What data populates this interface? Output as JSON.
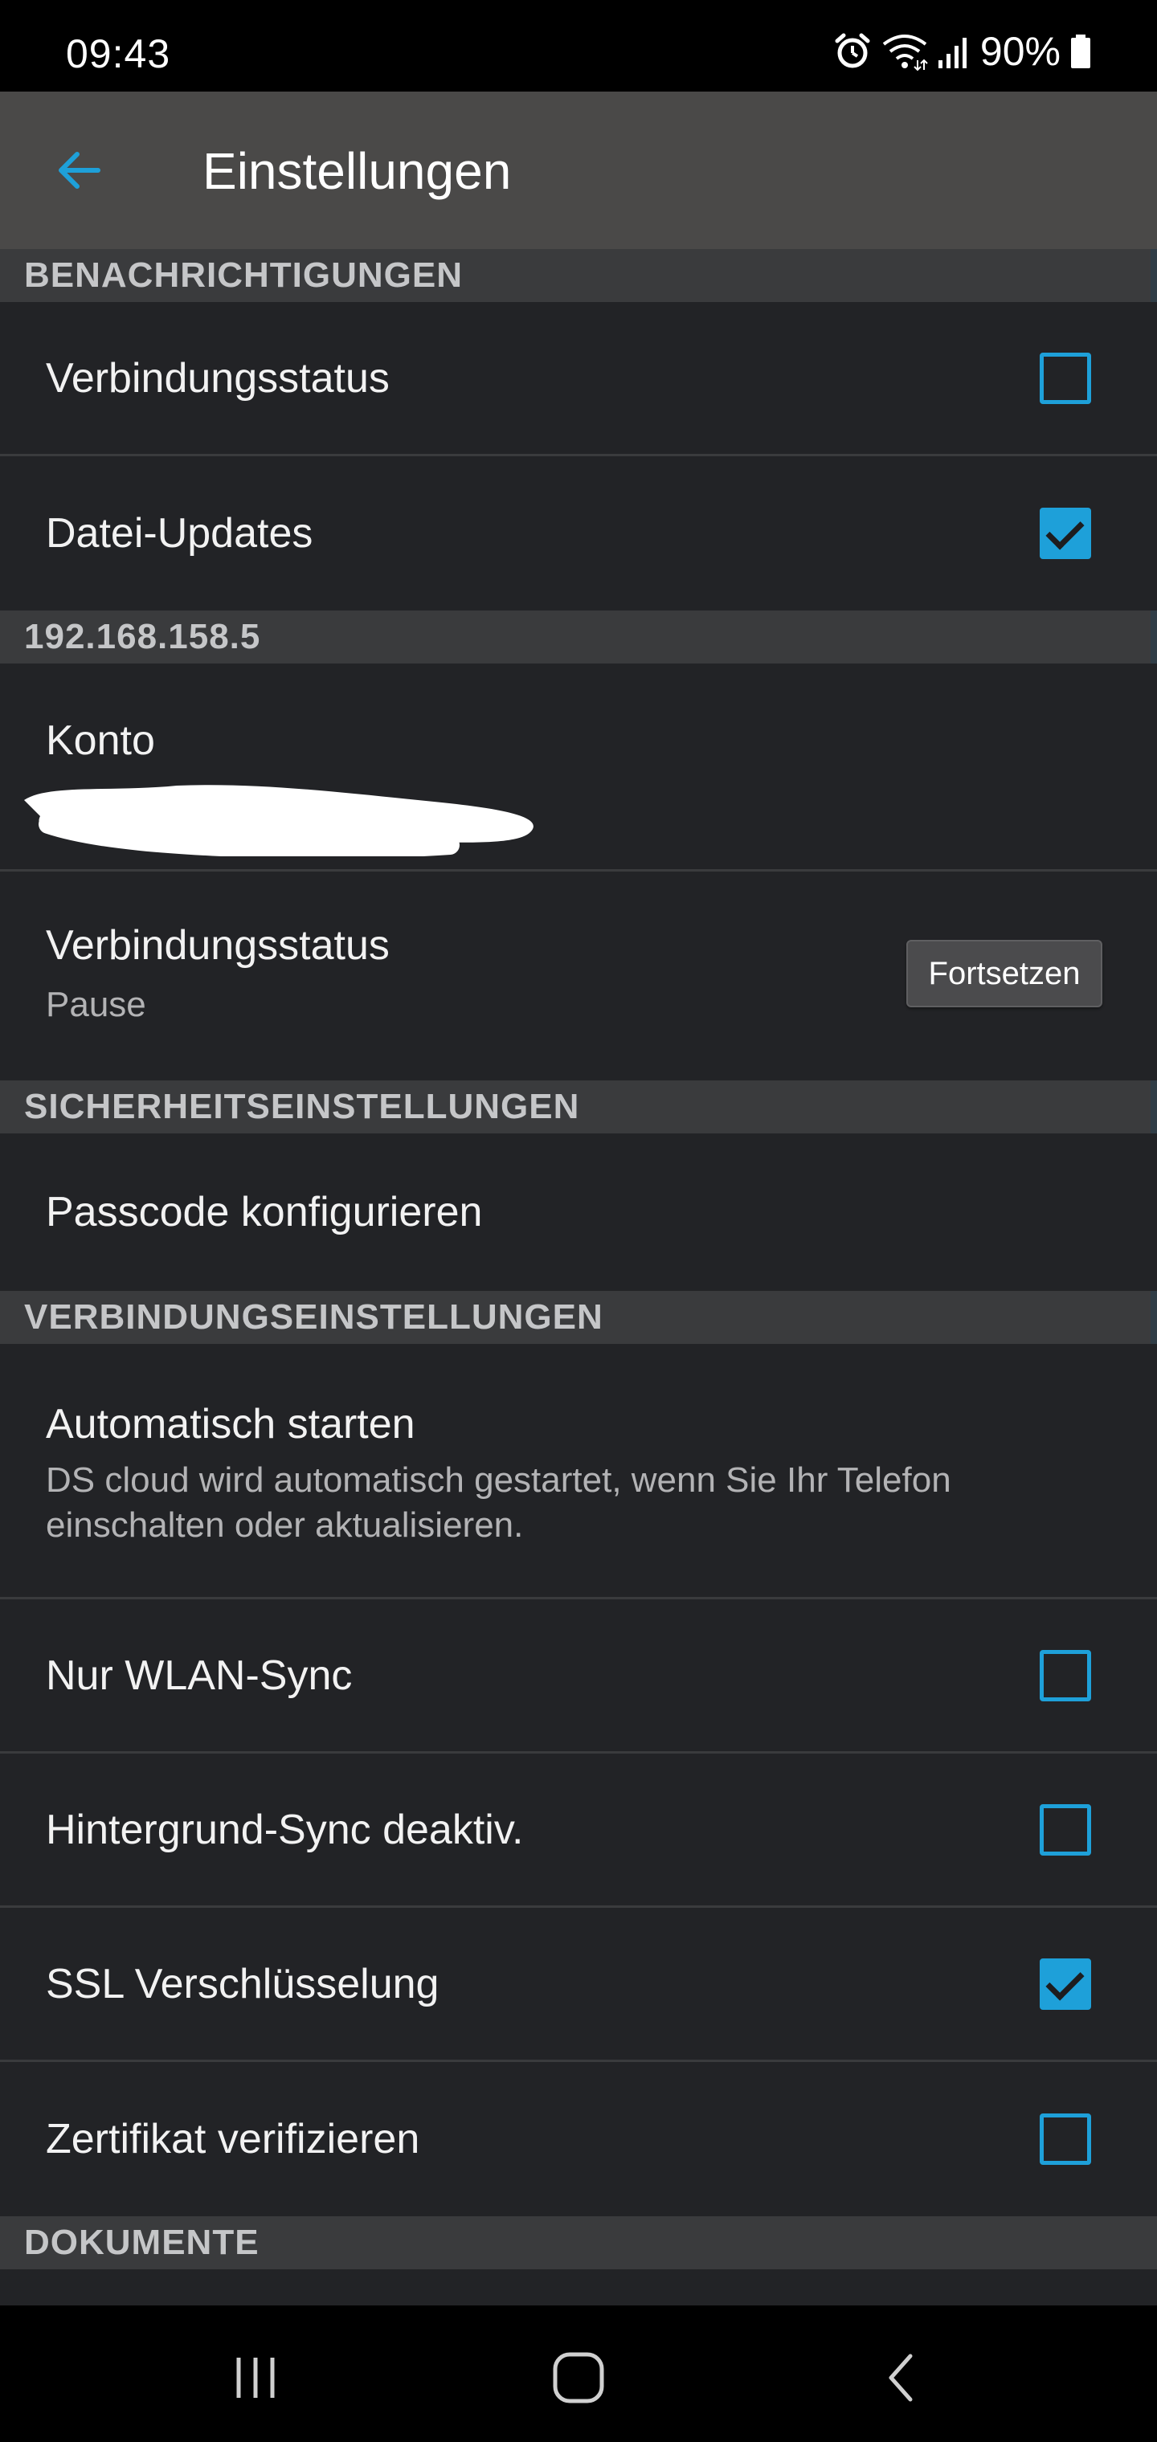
{
  "status_bar": {
    "time": "09:43",
    "battery": "90%",
    "icons": [
      "alarm-icon",
      "wifi-icon",
      "signal-icon",
      "battery-icon"
    ]
  },
  "app_bar": {
    "title": "Einstellungen",
    "back_icon": "arrow-left-icon"
  },
  "colors": {
    "accent": "#1ea0d9",
    "background": "#222326",
    "section_header": "#3a3b3d",
    "app_bar": "#4a4948"
  },
  "sections": {
    "notifications": {
      "header": "BENACHRICHTIGUNGEN",
      "connection_status": {
        "label": "Verbindungsstatus",
        "checked": false
      },
      "file_updates": {
        "label": "Datei-Updates",
        "checked": true
      }
    },
    "server": {
      "header": "192.168.158.5",
      "account": {
        "label": "Konto"
      },
      "connection_status": {
        "label": "Verbindungsstatus",
        "value": "Pause",
        "button": "Fortsetzen"
      }
    },
    "security": {
      "header": "SICHERHEITSEINSTELLUNGEN",
      "passcode": {
        "label": "Passcode konfigurieren"
      }
    },
    "connection": {
      "header": "VERBINDUNGSEINSTELLUNGEN",
      "autostart": {
        "label": "Automatisch starten",
        "description": "DS cloud wird automatisch gestartet, wenn Sie Ihr Telefon einschalten oder aktualisieren."
      },
      "wlan_sync": {
        "label": "Nur WLAN-Sync",
        "checked": false
      },
      "background_sync": {
        "label": "Hintergrund-Sync deaktiv.",
        "checked": false
      },
      "ssl": {
        "label": "SSL Verschlüsselung",
        "checked": true
      },
      "verify_cert": {
        "label": "Zertifikat verifizieren",
        "checked": false
      }
    },
    "documents": {
      "header": "DOKUMENTE"
    }
  },
  "nav_bar": {
    "icons": [
      "recents-icon",
      "home-icon",
      "back-icon"
    ]
  }
}
